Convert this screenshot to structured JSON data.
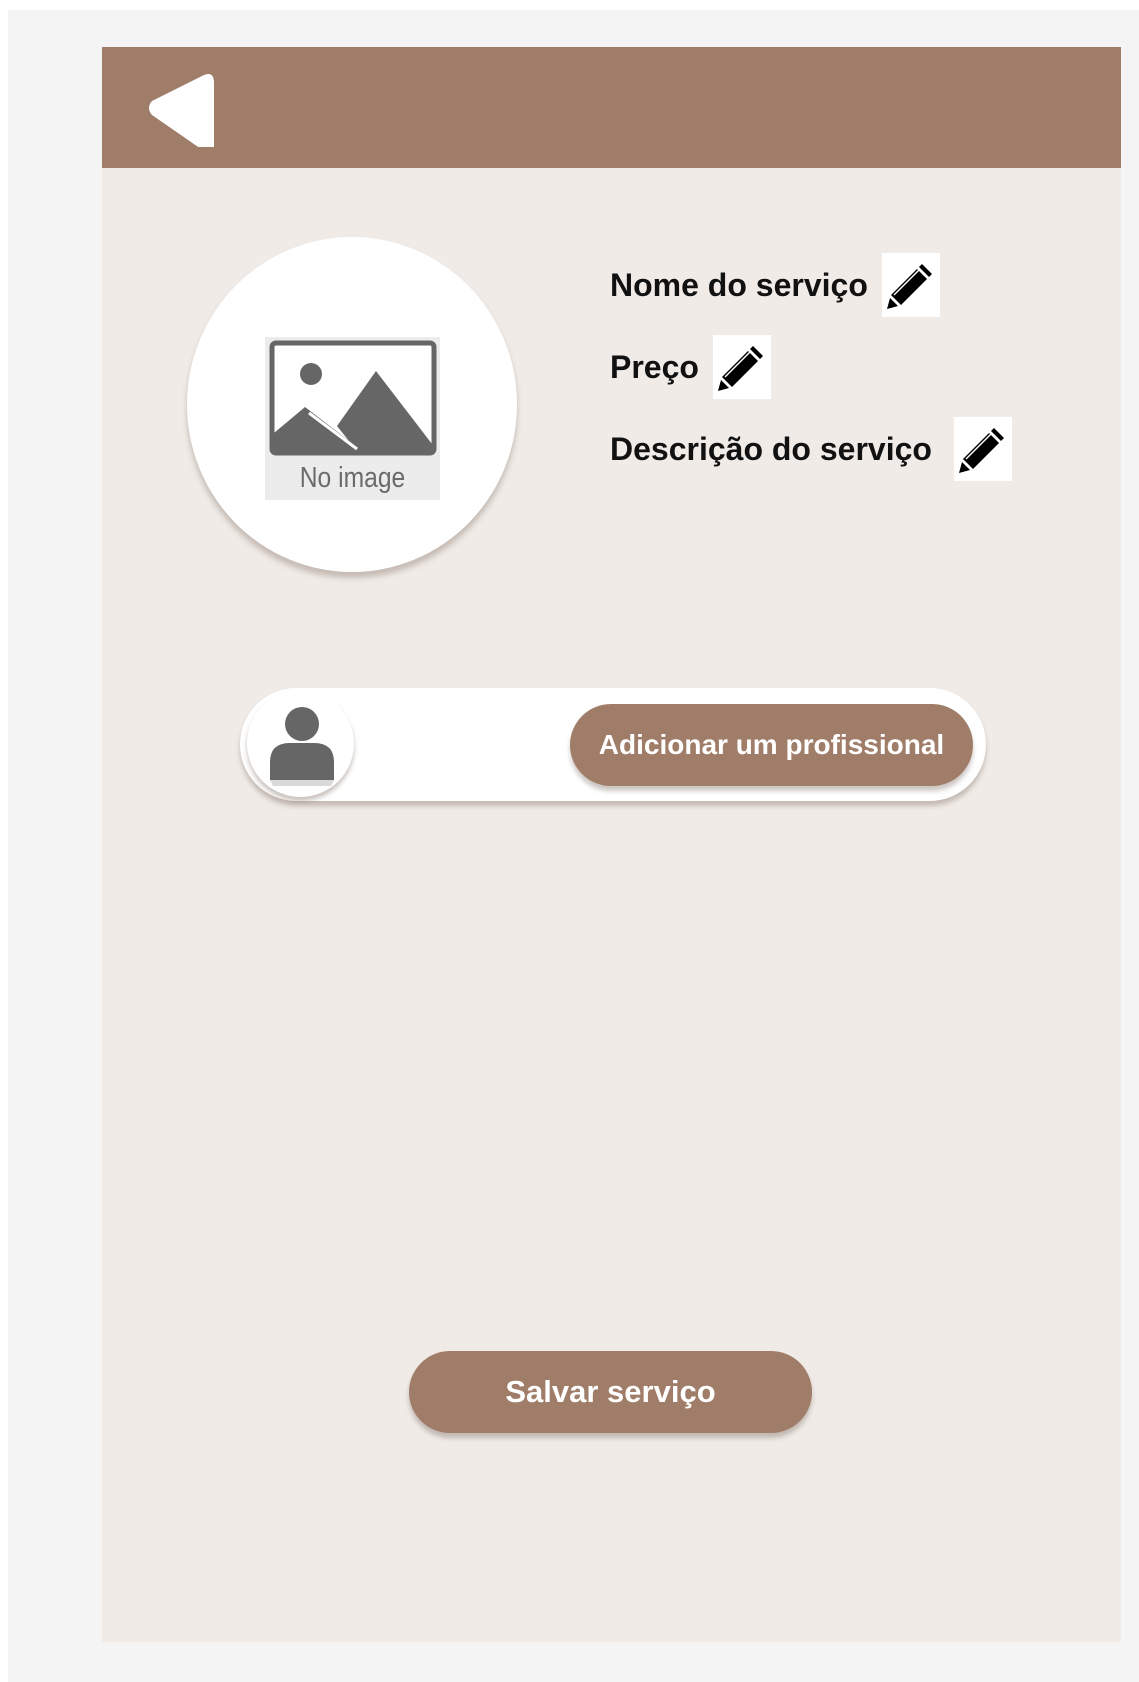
{
  "colors": {
    "outer_background": "#f4f4f4",
    "panel_background": "#f0ebe7",
    "header_background": "#a07d68",
    "button_background": "#a07d68",
    "button_text": "#ffffff",
    "icon_gray": "#666666"
  },
  "header": {
    "back_icon": "back-arrow-icon"
  },
  "photo": {
    "placeholder_icon": "no-image-icon",
    "placeholder_text": "No image"
  },
  "fields": {
    "nome_label": "Nome do serviço",
    "preco_label": "Preço",
    "descricao_label": "Descrição do serviço",
    "edit_icon": "pencil-icon"
  },
  "professional": {
    "avatar_icon": "user-icon",
    "add_button_label": "Adicionar um profissional"
  },
  "footer": {
    "save_button_label": "Salvar serviço"
  }
}
